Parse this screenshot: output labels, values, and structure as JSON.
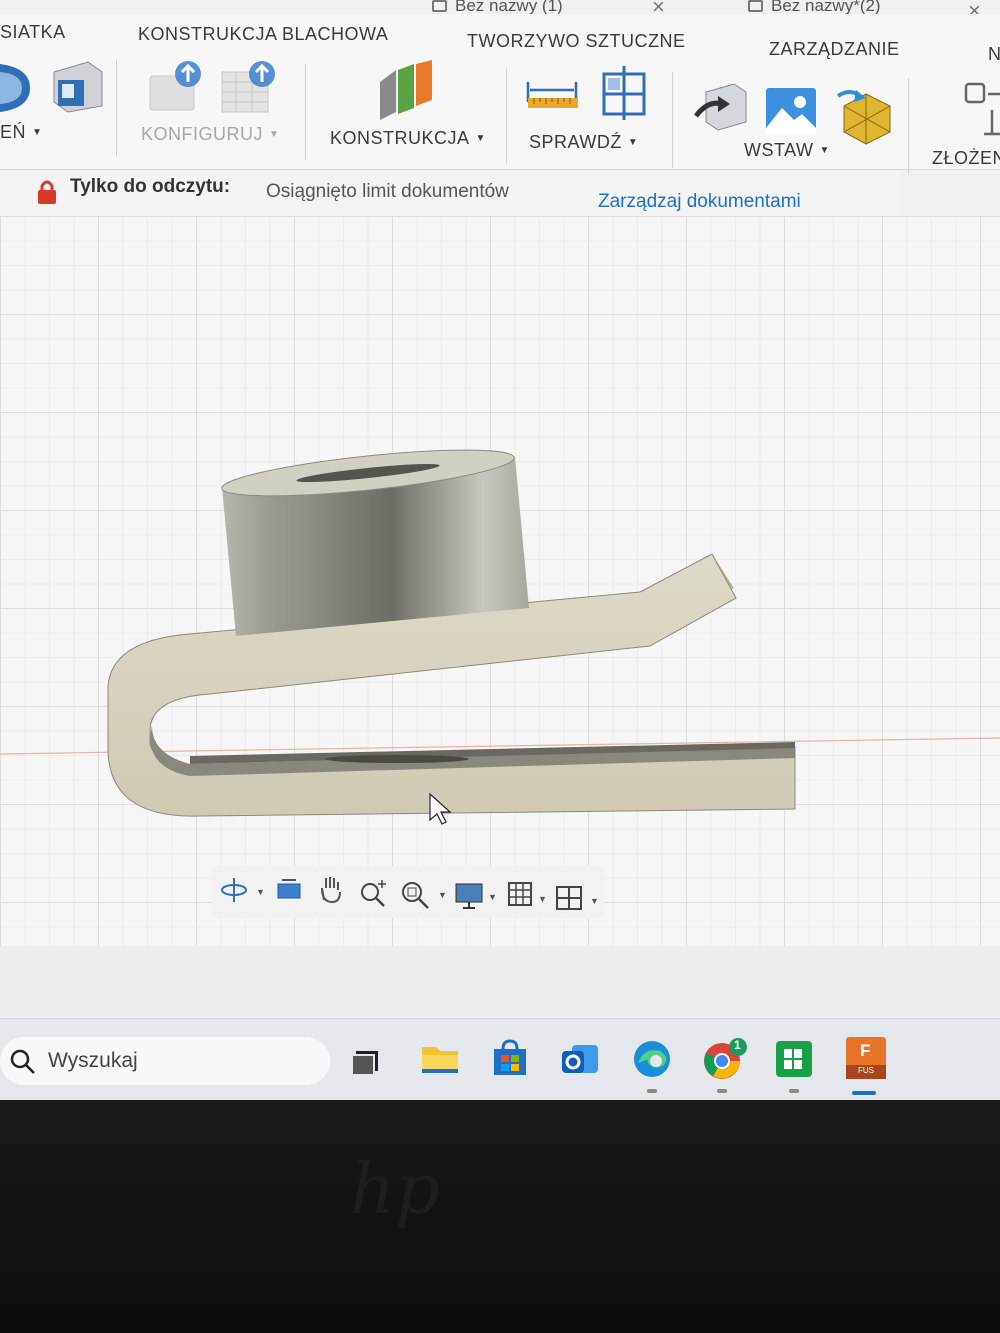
{
  "tabs": {
    "doc1": "Bez nazwy (1)",
    "doc2": "Bez nazwy*(2)"
  },
  "ribbon": {
    "tabs": {
      "siatka": "SIATKA",
      "blachowa": "KONSTRUKCJA BLACHOWA",
      "tworzywo": "TWORZYWO SZTUCZNE",
      "zarzadzanie": "ZARZĄDZANIE",
      "cut_n": "N"
    },
    "groups": {
      "cut_left": "EŃ",
      "konfiguruj": "KONFIGURUJ",
      "konstrukcja": "KONSTRUKCJA",
      "sprawdz": "SPRAWDŹ",
      "wstaw": "WSTAW",
      "zlozenie": "ZŁOŻEN"
    }
  },
  "readonly_bar": {
    "label": "Tylko do odczytu:",
    "message": "Osiągnięto limit dokumentów",
    "link": "Zarządzaj dokumentami"
  },
  "taskbar": {
    "search_placeholder": "Wyszukaj",
    "chrome_badge": "1",
    "fusion_label": "F",
    "fusion_sub": "FUS"
  },
  "bezel": {
    "logo": "hp"
  },
  "colors": {
    "accent_blue": "#1f6fc5",
    "lock_red": "#d93a2b",
    "model_face": "#d8d4c4",
    "fusion_orange": "#e8742a"
  }
}
